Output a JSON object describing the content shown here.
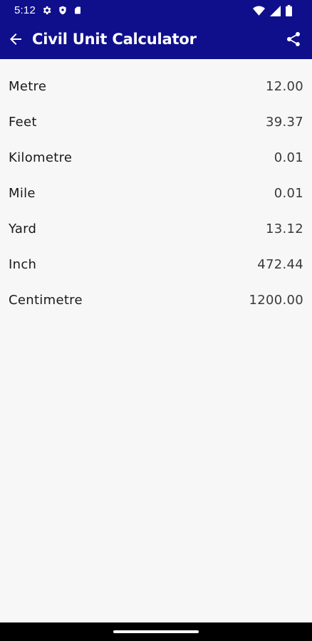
{
  "status_bar": {
    "time": "5:12",
    "left_icons": [
      "settings-icon",
      "shield-icon",
      "sim-card-icon"
    ],
    "right_icons": [
      "wifi-icon",
      "signal-icon",
      "battery-icon"
    ]
  },
  "app_bar": {
    "title": "Civil Unit Calculator"
  },
  "units": [
    {
      "name": "Metre",
      "value": "12.00"
    },
    {
      "name": "Feet",
      "value": "39.37"
    },
    {
      "name": "Kilometre",
      "value": "0.01"
    },
    {
      "name": "Mile",
      "value": "0.01"
    },
    {
      "name": "Yard",
      "value": "13.12"
    },
    {
      "name": "Inch",
      "value": "472.44"
    },
    {
      "name": "Centimetre",
      "value": "1200.00"
    }
  ],
  "colors": {
    "primary": "#0f0f8c",
    "background": "#f7f7f8"
  }
}
